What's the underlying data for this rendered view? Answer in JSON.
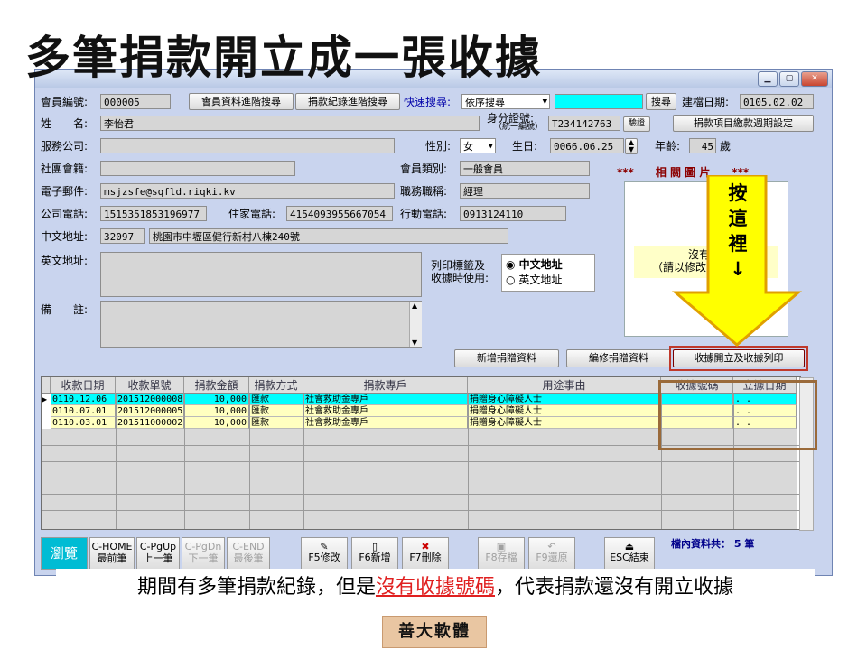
{
  "slide": {
    "title": "多筆捐款開立成一張收據",
    "caption_part1": "期間有多筆捐款紀錄，但是",
    "caption_highlight": "沒有收據號碼",
    "caption_part2": "，代表捐款還沒有開立收據",
    "brand": "善大軟體"
  },
  "window": {
    "minimize_icon": "minimize-icon",
    "maximize_icon": "maximize-icon",
    "close_icon": "close-icon"
  },
  "header": {
    "member_no_label": "會員編號:",
    "member_no_value": "000005",
    "advanced_member_search": "會員資料進階搜尋",
    "advanced_donation_search": "捐款紀錄進階搜尋",
    "quick_search_label": "快速搜尋:",
    "quick_search_value": "依序搜尋",
    "search_button": "搜尋",
    "created_date_label": "建檔日期:",
    "created_date_value": "0105.02.02"
  },
  "form": {
    "name_label": "姓　　名:",
    "name_value": "李怡君",
    "id_label": "身分證號:",
    "id_sublabel": "（統一編號）",
    "id_value": "T234142763",
    "verify_button": "驗證",
    "donation_period_button": "捐款項目繳款週期設定",
    "company_label": "服務公司:",
    "company_value": "",
    "gender_label": "性別:",
    "gender_value": "女",
    "birthday_label": "生日:",
    "birthday_value": "0066.06.25",
    "age_label": "年齡:",
    "age_value": "45",
    "age_unit": "歲",
    "group_label": "社團會籍:",
    "group_value": "",
    "member_type_label": "會員類別:",
    "member_type_value": "一般會員",
    "email_label": "電子郵件:",
    "email_value": "msjzsfe@sqfld.riqki.kv",
    "job_title_label": "職務職稱:",
    "job_title_value": "經理",
    "company_phone_label": "公司電話:",
    "company_phone_value": "1515351853196977",
    "home_phone_label": "住家電話:",
    "home_phone_value": "4154093955667054",
    "mobile_label": "行動電話:",
    "mobile_value": "0913124110",
    "cn_address_label": "中文地址:",
    "zip_value": "32097",
    "cn_address_value": "桃園市中壢區健行新村八棟240號",
    "en_address_label": "英文地址:",
    "en_address_value": "",
    "print_label_line1": "列印標籤及",
    "print_label_line2": "收據時使用:",
    "radio_cn": "中文地址",
    "radio_en": "英文地址",
    "notes_label": "備　　註:",
    "notes_value": ""
  },
  "photo": {
    "header": "***　　相 關 圖 片　　***",
    "text_line1": "沒有",
    "text_line2": "（請以修改"
  },
  "actions": {
    "add_donation": "新增捐贈資料",
    "edit_donation": "編修捐贈資料",
    "issue_receipt": "收據開立及收據列印"
  },
  "callout": {
    "text": "按這裡↓"
  },
  "table": {
    "columns": [
      "收款日期",
      "收款單號",
      "捐款金額",
      "捐款方式",
      "捐款專戶",
      "用途事由",
      "收據號碼",
      "立據日期"
    ],
    "rows": [
      [
        "0110.12.06",
        "201512000008",
        "10,000",
        "匯款",
        "社會救助金專戶",
        "捐贈身心障礙人士",
        "",
        ". ."
      ],
      [
        "0110.07.01",
        "201512000005",
        "10,000",
        "匯款",
        "社會救助金專戶",
        "捐贈身心障礙人士",
        "",
        ". ."
      ],
      [
        "0110.03.01",
        "201511000002",
        "10,000",
        "匯款",
        "社會救助金專戶",
        "捐贈身心障礙人士",
        "",
        ". ."
      ]
    ]
  },
  "toolbar": {
    "browse": "瀏覽",
    "first_line1": "C-HOME",
    "first_line2": "最前筆",
    "prev_line1": "C-PgUp",
    "prev_line2": "上一筆",
    "next_line1": "C-PgDn",
    "next_line2": "下一筆",
    "last_line1": "C-END",
    "last_line2": "最後筆",
    "edit": "F5修改",
    "add": "F6新增",
    "delete": "F7刪除",
    "save": "F8存檔",
    "restore": "F9還原",
    "exit": "ESC結束",
    "record_count": "檔內資料共： 5 筆"
  }
}
